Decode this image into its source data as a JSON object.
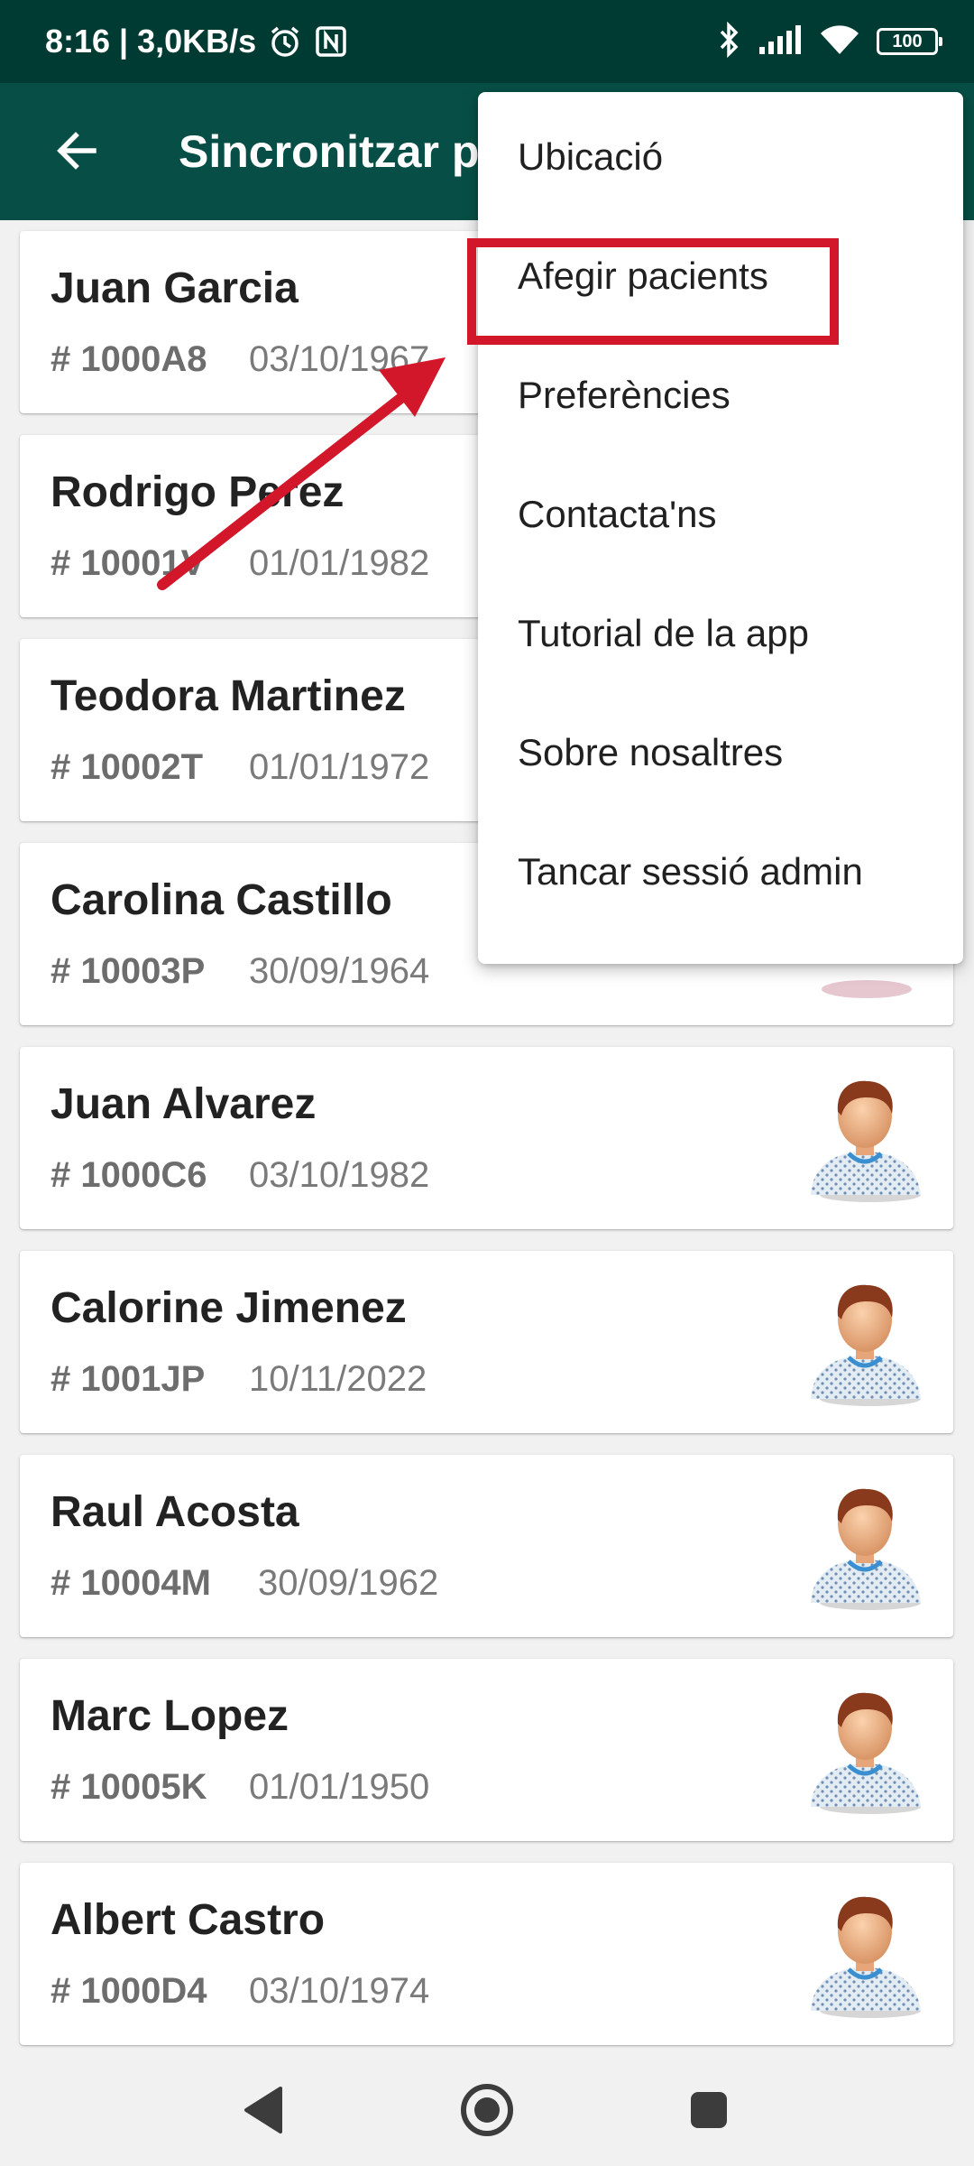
{
  "status_bar": {
    "time_speed": "8:16 | 3,0KB/s",
    "battery": "100",
    "icons": [
      "alarm-icon",
      "nfc-icon",
      "bluetooth-icon",
      "signal-icon",
      "wifi-icon",
      "battery-icon"
    ]
  },
  "app_bar": {
    "title": "Sincronitzar p",
    "back_icon": "arrow-left-icon"
  },
  "patients": [
    {
      "name": "Juan Garcia",
      "id": "# 1000A8",
      "dob": "03/10/1967"
    },
    {
      "name": "Rodrigo Perez",
      "id": "# 10001V",
      "dob": "01/01/1982"
    },
    {
      "name": "Teodora Martinez",
      "id": "# 10002T",
      "dob": "01/01/1972"
    },
    {
      "name": "Carolina Castillo",
      "id": "# 10003P",
      "dob": "30/09/1964"
    },
    {
      "name": "Juan Alvarez",
      "id": "# 1000C6",
      "dob": "03/10/1982"
    },
    {
      "name": "Calorine Jimenez",
      "id": "# 1001JP",
      "dob": "10/11/2022"
    },
    {
      "name": "Raul Acosta",
      "id": "# 10004M",
      "dob": "30/09/1962"
    },
    {
      "name": "Marc Lopez",
      "id": "# 10005K",
      "dob": "01/01/1950"
    },
    {
      "name": "Albert Castro",
      "id": "# 1000D4",
      "dob": "03/10/1974"
    }
  ],
  "menu": {
    "items": [
      {
        "label": "Ubicació"
      },
      {
        "label": "Afegir pacients"
      },
      {
        "label": "Preferències"
      },
      {
        "label": "Contacta'ns"
      },
      {
        "label": "Tutorial de la app"
      },
      {
        "label": "Sobre nosaltres"
      },
      {
        "label": "Tancar sessió admin"
      }
    ],
    "highlighted_index": 1
  },
  "annotation_color": "#d3172a",
  "nav_bar": {
    "icons": [
      "back-triangle-icon",
      "home-circle-icon",
      "recents-square-icon"
    ]
  }
}
